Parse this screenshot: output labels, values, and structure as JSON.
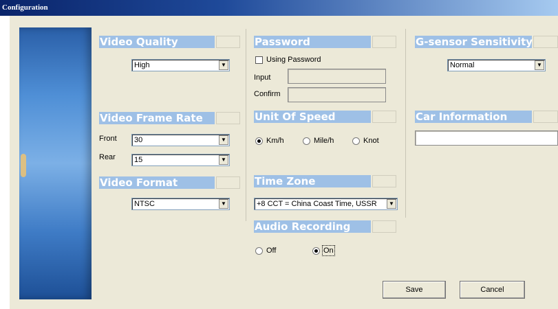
{
  "window": {
    "title": "Configuration"
  },
  "video_quality": {
    "header": "Video Quality",
    "value": "High"
  },
  "video_frame_rate": {
    "header": "Video Frame Rate",
    "front_label": "Front",
    "front_value": "30",
    "rear_label": "Rear",
    "rear_value": "15"
  },
  "video_format": {
    "header": "Video Format",
    "value": "NTSC"
  },
  "password": {
    "header": "Password",
    "using_label": "Using Password",
    "using_checked": false,
    "input_label": "Input",
    "confirm_label": "Confirm"
  },
  "unit_of_speed": {
    "header": "Unit Of Speed",
    "options": [
      "Km/h",
      "Mile/h",
      "Knot"
    ],
    "selected": "Km/h"
  },
  "time_zone": {
    "header": "Time Zone",
    "value": "+8   CCT = China Coast Time, USSR"
  },
  "audio_recording": {
    "header": "Audio Recording",
    "options": [
      "Off",
      "On"
    ],
    "selected": "On"
  },
  "g_sensor": {
    "header": "G-sensor Sensitivity",
    "value": "Normal"
  },
  "car_information": {
    "header": "Car Information",
    "value": ""
  },
  "buttons": {
    "save": "Save",
    "cancel": "Cancel"
  }
}
